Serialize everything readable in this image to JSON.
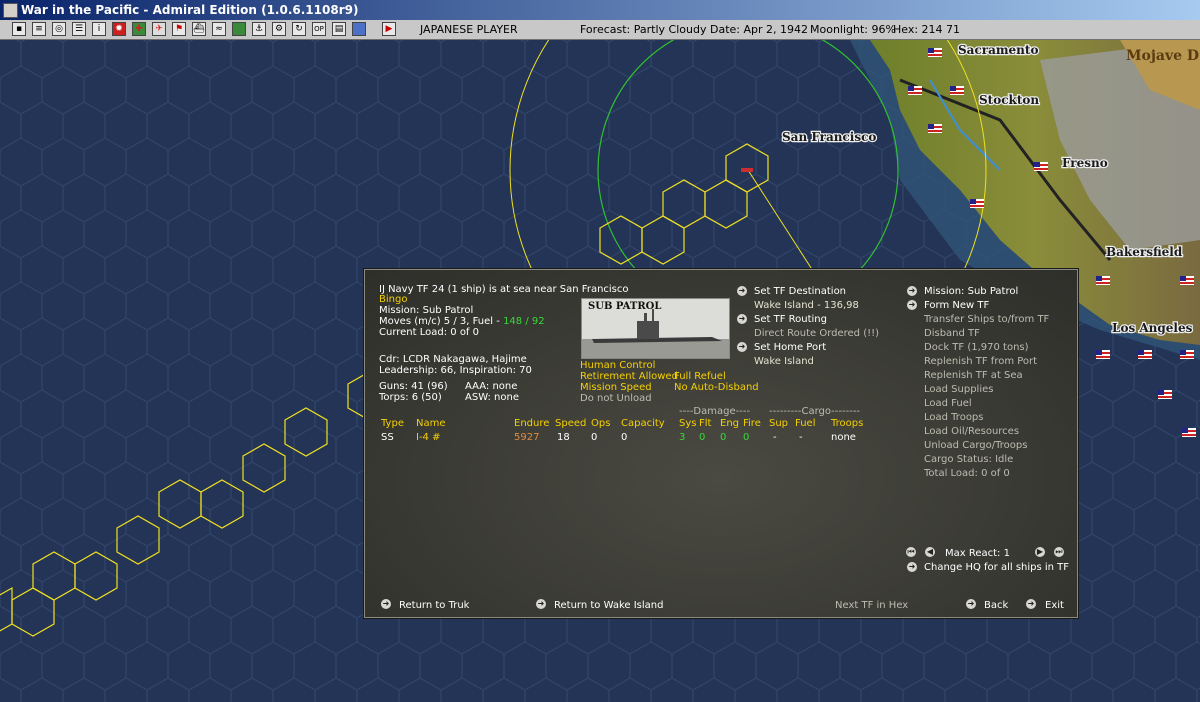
{
  "window": {
    "title": "War in the Pacific - Admiral Edition (1.0.6.1108r9)"
  },
  "toolbar": {
    "player": "JAPANESE PLAYER",
    "forecast": "Forecast: Partly Cloudy",
    "date": "Date: Apr 2, 1942",
    "moonlight": "Moonlight: 96%",
    "hex": "Hex: 214 71"
  },
  "map": {
    "cities": [
      "Sacramento",
      "Stockton",
      "San Francisco",
      "Fresno",
      "Bakersfield",
      "Los Angeles",
      "Mojave D"
    ]
  },
  "panel": {
    "tf_title": "IJ Navy TF 24 (1 ship) is at sea near San Francisco",
    "status": "Bingo",
    "mission": "Mission: Sub Patrol",
    "moves_label": "Moves (m/c) 5 / 3, Fuel -",
    "moves_fuel": "148 / 92",
    "current_load": "Current Load: 0 of 0",
    "mission_image_caption": "SUB PATROL",
    "commander": "Cdr: LCDR Nakagawa, Hajime",
    "leadership": "Leadership: 66, Inspiration: 70",
    "guns": "Guns: 41 (96)",
    "aaa": "AAA: none",
    "torps": "Torps: 6 (50)",
    "asw": "ASW: none",
    "options": {
      "human_control": "Human Control",
      "retirement": "Retirement Allowed",
      "full_refuel": "Full Refuel",
      "mission_speed": "Mission Speed",
      "no_auto_disband": "No Auto-Disband",
      "do_not_unload": "Do not Unload"
    },
    "nav": {
      "set_destination": "Set TF Destination",
      "destination_value": "Wake Island - 136,98",
      "set_routing": "Set TF Routing",
      "routing_value": "Direct Route Ordered (!!)",
      "set_home_port": "Set Home Port",
      "home_port_value": "Wake Island"
    },
    "actions": {
      "mission": "Mission: Sub Patrol",
      "form_new_tf": "Form New TF",
      "items": [
        "Transfer Ships to/from TF",
        "Disband TF",
        "Dock TF (1,970 tons)",
        "Replenish TF from Port",
        "Replenish TF at Sea",
        "Load Supplies",
        "Load Fuel",
        "Load Troops",
        "Load Oil/Resources",
        "Unload Cargo/Troops",
        "Cargo Status: Idle",
        "Total Load: 0 of 0"
      ],
      "max_react": "Max React: 1",
      "change_hq": "Change HQ for all ships in TF"
    },
    "ship_table": {
      "damage_group": "----Damage----",
      "cargo_group": "---------Cargo--------",
      "headers": [
        "Type",
        "Name",
        "Endure",
        "Speed",
        "Ops",
        "Capacity",
        "Sys",
        "Flt",
        "Eng",
        "Fire",
        "Sup",
        "Fuel",
        "Troops"
      ],
      "rows": [
        {
          "type": "SS",
          "name": "I-4 #",
          "endure": "5927",
          "speed": "18",
          "ops": "0",
          "capacity": "0",
          "sys": "3",
          "flt": "0",
          "eng": "0",
          "fire": "0",
          "sup": "-",
          "fuel": "-",
          "troops": "none"
        }
      ]
    },
    "footer": {
      "return_truk": "Return to Truk",
      "return_wake": "Return to Wake Island",
      "next_tf": "Next TF in Hex",
      "back": "Back",
      "exit": "Exit"
    }
  },
  "colors": {
    "ocean": "#243456",
    "hex_line": "#2c3e63",
    "range_yellow": "#f0e020",
    "range_green": "#30c030",
    "highlight": "#f5d000"
  }
}
